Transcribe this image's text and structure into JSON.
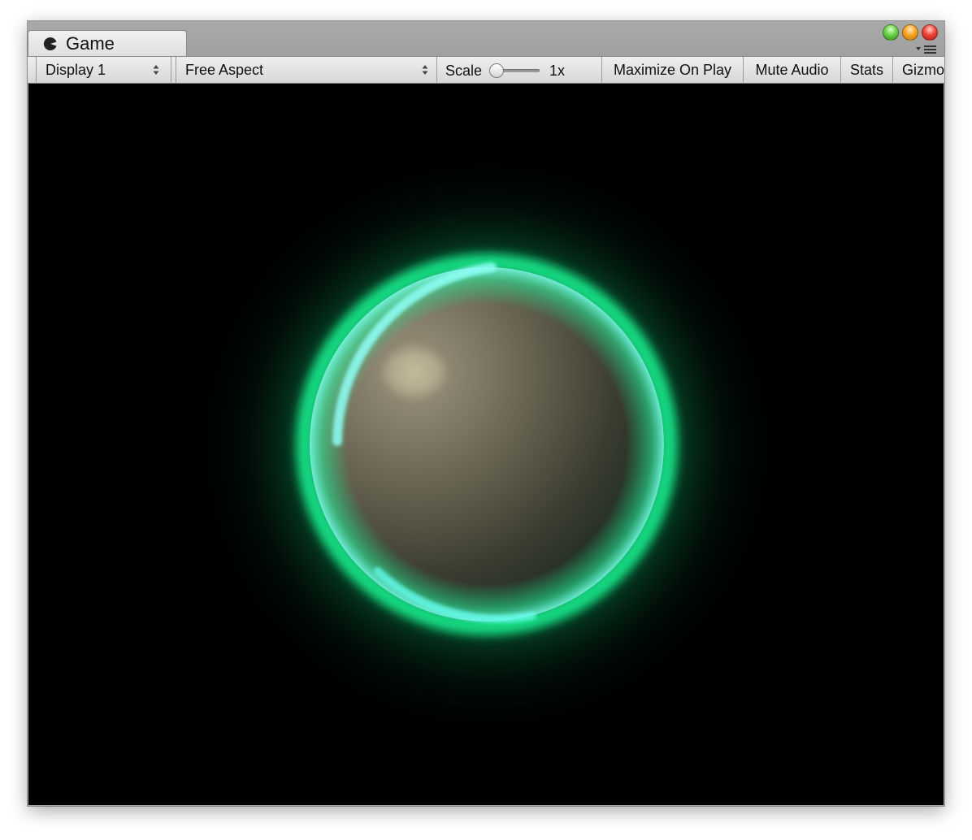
{
  "window": {
    "tab_title": "Game",
    "tab_icon": "pacman-game-icon",
    "window_controls": [
      "green-zoom-button",
      "yellow-minimize-button",
      "red-close-button"
    ]
  },
  "toolbar": {
    "display_select": "Display 1",
    "aspect_select": "Free Aspect",
    "scale_label": "Scale",
    "scale_value": "1x",
    "scale_slider_level": 0.0,
    "maximize_label": "Maximize On Play",
    "mute_label": "Mute Audio",
    "stats_label": "Stats",
    "gizmos_label": "Gizmos"
  },
  "scene": {
    "background": "#000000",
    "glow_color": "#19e88a",
    "rim_color": "#5ffff0",
    "sphere_color": "#6b6856"
  }
}
